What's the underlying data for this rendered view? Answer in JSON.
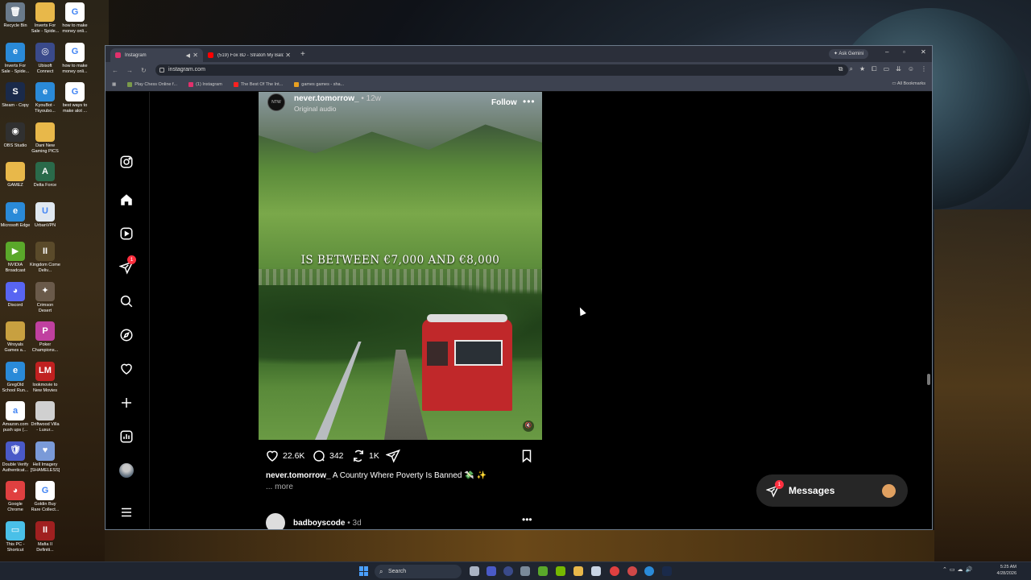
{
  "desktop": {
    "icons": [
      {
        "label": "Recycle Bin",
        "glyph": "🗑",
        "color": "#6a7a8a"
      },
      {
        "label": "Inverts For Sale - Spide...",
        "glyph": "",
        "color": "#e8b84a"
      },
      {
        "label": "how to make money onli...",
        "glyph": "G",
        "color": "#ffffff"
      },
      {
        "label": "Inverts For Sale - Spide...",
        "glyph": "e",
        "color": "#2a8ad8"
      },
      {
        "label": "Ubisoft Connect",
        "glyph": "◎",
        "color": "#3a4a8a"
      },
      {
        "label": "how to make money onli...",
        "glyph": "G",
        "color": "#ffffff"
      },
      {
        "label": "Steam - Copy",
        "glyph": "S",
        "color": "#1a2a4a"
      },
      {
        "label": "KyouBot - Tkyoubo...",
        "glyph": "e",
        "color": "#2a8ad8"
      },
      {
        "label": "best ways to make alot ...",
        "glyph": "G",
        "color": "#ffffff"
      },
      {
        "label": "OBS Studio",
        "glyph": "◉",
        "color": "#303030"
      },
      {
        "label": "Dani New Gaming PICS",
        "glyph": "",
        "color": "#e8b84a"
      },
      {
        "label": "GAMEZ",
        "glyph": "",
        "color": "#e8b84a"
      },
      {
        "label": "Delta Force",
        "glyph": "A",
        "color": "#2a6a4a"
      },
      {
        "label": "Microsoft Edge",
        "glyph": "e",
        "color": "#2a8ad8"
      },
      {
        "label": "UrbanVPN",
        "glyph": "U",
        "color": "#e0e8f0"
      },
      {
        "label": "NVIDIA Broadcast",
        "glyph": "▶",
        "color": "#5aa82a"
      },
      {
        "label": "Kingdom Come Deliv...",
        "glyph": "II",
        "color": "#5a4a2a"
      },
      {
        "label": "Discord",
        "glyph": "◕",
        "color": "#5865f2"
      },
      {
        "label": "Crimson Desert",
        "glyph": "✦",
        "color": "#6a5a4a"
      },
      {
        "label": "Wroyals Games a...",
        "glyph": "",
        "color": "#c8a040"
      },
      {
        "label": "Poker Champions...",
        "glyph": "P",
        "color": "#c040a0"
      },
      {
        "label": "GregOld School Run...",
        "glyph": "e",
        "color": "#2a8ad8"
      },
      {
        "label": "lookmovie to New Movies",
        "glyph": "LM",
        "color": "#c02020"
      },
      {
        "label": "Amazon.com push ups (...",
        "glyph": "a",
        "color": "#ffffff"
      },
      {
        "label": "Driftwood Villa - Luxur...",
        "glyph": "",
        "color": "#d0d0d0"
      },
      {
        "label": "Double Verify Authenticat...",
        "glyph": "🛡",
        "color": "#4a5ac8"
      },
      {
        "label": "Hell Imagery [SHAMELESS]",
        "glyph": "♥",
        "color": "#7a9ad8"
      },
      {
        "label": "Google Chrome",
        "glyph": "◕",
        "color": "#e04040"
      },
      {
        "label": "Goldin Buy Rare Collect...",
        "glyph": "G",
        "color": "#ffffff"
      },
      {
        "label": "This PC - Shortcut",
        "glyph": "▭",
        "color": "#4ac0e8"
      },
      {
        "label": "Mafia II Definiti...",
        "glyph": "II",
        "color": "#a02020"
      }
    ]
  },
  "browser": {
    "tabs": [
      {
        "title": "Instagram",
        "active": true,
        "color": "#e1306c"
      },
      {
        "title": "(519) Fox 8D - Stratoh My Bald...",
        "active": false,
        "color": "#ff0000"
      }
    ],
    "new_tab": "+",
    "ask_gemini": "Ask Gemini",
    "window_controls": {
      "minimize": "–",
      "maximize": "▫",
      "close": "✕"
    },
    "url": "instagram.com",
    "bookmarks": [
      {
        "label": "Play Chess Online f...",
        "color": "#7a9a4a"
      },
      {
        "label": "(1) Instagram",
        "color": "#e1306c"
      },
      {
        "label": "The Best Of The Int...",
        "color": "#ff2020"
      },
      {
        "label": "games games - sha...",
        "color": "#e8a020"
      }
    ],
    "all_bookmarks": "All Bookmarks"
  },
  "instagram": {
    "notifications_badge": "1",
    "post": {
      "avatar_text": "NTW",
      "username": "never.tomorrow_",
      "age": " • 12w",
      "audio": "Original audio",
      "follow": "Follow",
      "more_dots": "•••",
      "overlay_text": "IS BETWEEN €7,000 AND €8,000",
      "likes": "22.6K",
      "comments": "342",
      "reposts": "1K",
      "caption_user": "never.tomorrow_",
      "caption_text": " A Country Where Poverty Is Banned 💸 ✨",
      "more": "... more"
    },
    "next_post": {
      "username": "badboyscode",
      "age": " • 3d",
      "dots": "•••"
    },
    "messages": {
      "label": "Messages",
      "badge": "1"
    }
  },
  "taskbar": {
    "search_placeholder": "Search",
    "clock_time": "5:25 AM",
    "clock_date": "4/28/2026"
  }
}
